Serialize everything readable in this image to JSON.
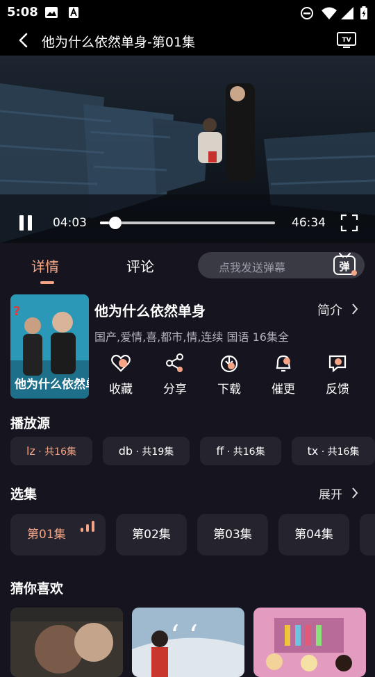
{
  "status_bar": {
    "time": "5:08"
  },
  "header": {
    "title": "他为什么依然单身-第01集"
  },
  "player": {
    "current_time": "04:03",
    "duration": "46:34",
    "progress": 0.087
  },
  "tabs": [
    {
      "label": "详情",
      "active": true
    },
    {
      "label": "评论",
      "active": false
    }
  ],
  "danmu": {
    "placeholder": "点我发送弹幕",
    "icon_label": "弹"
  },
  "show": {
    "title": "他为什么依然单身",
    "intro_label": "简介",
    "tags": "国产,爱情,喜,都市,情,连续 国语 16集全",
    "poster_text": "他为什么依然单身"
  },
  "actions": [
    {
      "label": "收藏",
      "icon": "heart-icon"
    },
    {
      "label": "分享",
      "icon": "share-icon"
    },
    {
      "label": "下载",
      "icon": "download-icon"
    },
    {
      "label": "催更",
      "icon": "bell-icon"
    },
    {
      "label": "反馈",
      "icon": "feedback-icon"
    }
  ],
  "sources": {
    "title": "播放源",
    "items": [
      {
        "name": "lz",
        "count": " · 共16集",
        "active": true
      },
      {
        "name": "db",
        "count": " · 共19集",
        "active": false
      },
      {
        "name": "ff",
        "count": " · 共16集",
        "active": false
      },
      {
        "name": "tx",
        "count": " · 共16集",
        "active": false
      }
    ]
  },
  "episodes": {
    "title": "选集",
    "expand_label": "展开",
    "items": [
      {
        "label": "第01集",
        "active": true
      },
      {
        "label": "第02集",
        "active": false
      },
      {
        "label": "第03集",
        "active": false
      },
      {
        "label": "第04集",
        "active": false
      }
    ]
  },
  "recommend": {
    "title": "猜你喜欢"
  },
  "colors": {
    "accent": "#f5a585",
    "background": "#16151f",
    "chip": "#24232e"
  }
}
